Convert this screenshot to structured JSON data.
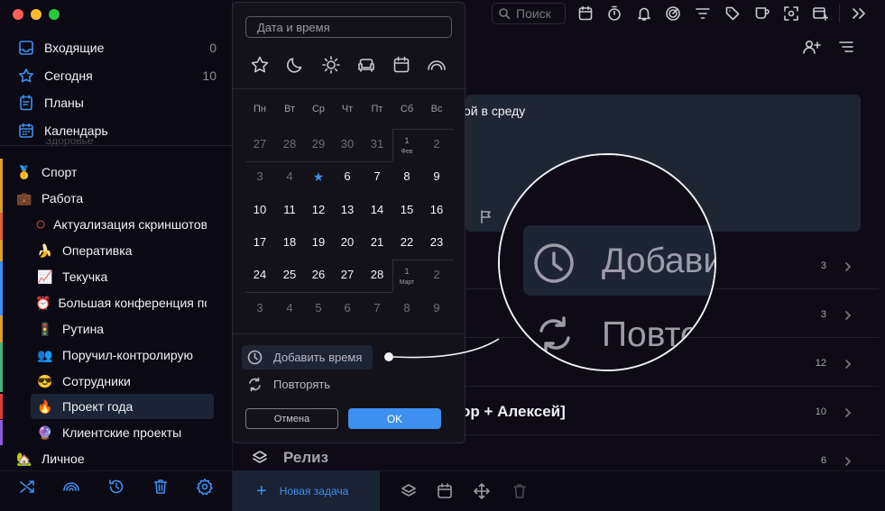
{
  "sidebar": {
    "nav": [
      {
        "label": "Входящие",
        "count": "0",
        "icon": "inbox-icon"
      },
      {
        "label": "Сегодня",
        "count": "10",
        "icon": "star-icon"
      },
      {
        "label": "Планы",
        "count": "",
        "icon": "plans-icon"
      },
      {
        "label": "Календарь",
        "count": "",
        "icon": "calendar-icon"
      }
    ],
    "cut_item": "Здоровье",
    "groups": [
      {
        "emoji": "🥇",
        "label": "Спорт"
      },
      {
        "emoji": "💼",
        "label": "Работа"
      }
    ],
    "projects": [
      {
        "emoji": "○",
        "label": "Актуализация скриншотов"
      },
      {
        "emoji": "🍌",
        "label": "Оперативка"
      },
      {
        "emoji": "📈",
        "label": "Текучка"
      },
      {
        "emoji": "⏰",
        "label": "Большая конференция по"
      },
      {
        "emoji": "🚦",
        "label": "Рутина"
      },
      {
        "emoji": "👥",
        "label": "Поручил-контролирую"
      },
      {
        "emoji": "😎",
        "label": "Сотрудники"
      },
      {
        "emoji": "🔥",
        "label": "Проект года"
      },
      {
        "emoji": "🔮",
        "label": "Клиентские проекты"
      }
    ],
    "personal": {
      "emoji": "🏡",
      "label": "Личное"
    },
    "bottom_icons": [
      "shuffle-icon",
      "rainbow-icon",
      "history-icon",
      "trash-icon",
      "settings-icon"
    ]
  },
  "topbar": {
    "search_placeholder": "Поиск",
    "icons": [
      "calendar-icon",
      "timer-icon",
      "bell-icon",
      "radar-icon",
      "filter-icon",
      "tag-icon",
      "coffee-icon",
      "focus-icon",
      "add-window-icon",
      "expand-icon"
    ]
  },
  "main": {
    "card_title": "ой в среду",
    "rows": [
      {
        "title": "",
        "count": "3"
      },
      {
        "title": "",
        "count": "3"
      },
      {
        "title": "",
        "count": "12"
      },
      {
        "title": "ор + Алексей]",
        "count": "10"
      },
      {
        "title": "Релиз",
        "count": "6"
      }
    ],
    "new_task": "Новая задача"
  },
  "popup": {
    "input_placeholder": "Дата и время",
    "quick_icons": [
      "star-icon",
      "moon-icon",
      "sun-icon",
      "sofa-icon",
      "calendar-icon",
      "rainbow-icon"
    ],
    "weekdays": [
      "Пн",
      "Вт",
      "Ср",
      "Чт",
      "Пт",
      "Сб",
      "Вс"
    ],
    "weeks": [
      [
        "27",
        "28",
        "29",
        "30",
        "31",
        "1|Фев",
        "2"
      ],
      [
        "3",
        "4",
        "★",
        "6",
        "7",
        "8",
        "9"
      ],
      [
        "10",
        "11",
        "12",
        "13",
        "14",
        "15",
        "16"
      ],
      [
        "17",
        "18",
        "19",
        "20",
        "21",
        "22",
        "23"
      ],
      [
        "24",
        "25",
        "26",
        "27",
        "28",
        "1|Март",
        "2"
      ],
      [
        "3",
        "4",
        "5",
        "6",
        "7",
        "8",
        "9"
      ]
    ],
    "add_time": "Добавить время",
    "repeat": "Повторять",
    "cancel": "Отмена",
    "ok": "OK"
  },
  "magnifier": {
    "add_time": "Добавить",
    "repeat": "Повто"
  },
  "colors": {
    "accent": "#3d8ff0",
    "bg": "#0e0b16",
    "sidebar": "#0b0913",
    "popup": "#141219"
  }
}
